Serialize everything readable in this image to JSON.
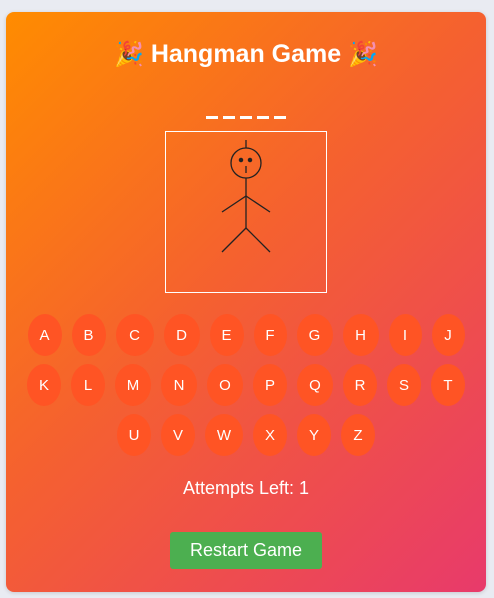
{
  "game": {
    "title": "Hangman Game",
    "emoji_left": "🎉",
    "emoji_right": "🎉",
    "word_slots": [
      "",
      "",
      "",
      "",
      ""
    ],
    "attempts_label": "Attempts Left: 1",
    "restart_label": "Restart Game"
  },
  "keyboard": {
    "rows": [
      [
        "A",
        "B",
        "C",
        "D",
        "E",
        "F",
        "G",
        "H",
        "I",
        "J"
      ],
      [
        "K",
        "L",
        "M",
        "N",
        "O",
        "P",
        "Q",
        "R",
        "S",
        "T"
      ],
      [
        "U",
        "V",
        "W",
        "X",
        "Y",
        "Z"
      ]
    ]
  },
  "colors": {
    "card_gradient_start": "#ff8c00",
    "card_gradient_end": "#e83a6b",
    "key_bg": "#ff5424",
    "restart_bg": "#4caf50"
  }
}
